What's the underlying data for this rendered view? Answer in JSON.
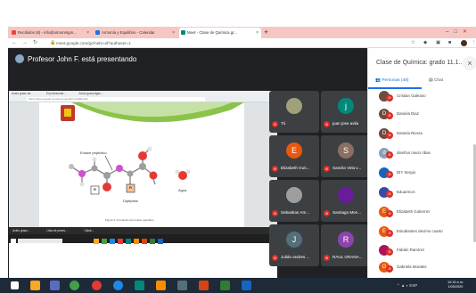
{
  "browser": {
    "tabs": [
      {
        "label": "Recibidos (8) - info@armonmgm...",
        "icon_color": "#e8453c"
      },
      {
        "label": "Armonía y Equilibrio - Calendar",
        "icon_color": "#1a73e8"
      },
      {
        "label": "Meet - Clase de Química gr...",
        "icon_color": "#00897b"
      }
    ],
    "url": "meet.google.com/gd-hebi-uif?authuser=1"
  },
  "stage": {
    "presenter_text": "Profesor John F. está presentando",
    "shared_tabs": [
      "Acido graso de...",
      "El profesional...",
      "Acido grasa ligan..."
    ],
    "shared_url": "https://docs.google.com/document/d/1yV3h8e/edit",
    "shared_taskbar": [
      "Acido graso...",
      "Lista de peces...",
      "Clase..."
    ],
    "diagram": {
      "label_peptide": "Enlace peptídico",
      "label_dipeptide": "Dipéptido",
      "label_water": "Agua",
      "label_r": "R",
      "caption": "Figura 3. Formación del enlace peptídico."
    }
  },
  "tiles": [
    {
      "name": "Tú",
      "initial": "",
      "color": "#a0a07a"
    },
    {
      "name": "juan jose avila",
      "initial": "j",
      "color": "#00897b"
    },
    {
      "name": "Elizabeth Guti...",
      "initial": "E",
      "color": "#e8590c"
    },
    {
      "name": "Sandra Vela v...",
      "initial": "S",
      "color": "#8d6e63"
    },
    {
      "name": "Sebastian Am...",
      "initial": "",
      "color": "#9e9e9e"
    },
    {
      "name": "Santiago Men...",
      "initial": "",
      "color": "#6a1b9a"
    },
    {
      "name": "Julián andres ...",
      "initial": "J",
      "color": "#546e7a"
    },
    {
      "name": "RAUL GRANA...",
      "initial": "R",
      "color": "#8e44ad"
    }
  ],
  "panel": {
    "title": "Clase de Química: grado 11.1...",
    "tab_people": "Personas (48)",
    "tab_chat": "Chat",
    "people": [
      {
        "name": "Cristian Galeano",
        "initial": "",
        "color": "#6d4c41"
      },
      {
        "name": "Daniela Diaz",
        "initial": "D",
        "color": "#6d4c41"
      },
      {
        "name": "Daniela Rivera",
        "initial": "D",
        "color": "#6d4c41"
      },
      {
        "name": "diseños marci ribas",
        "initial": "d",
        "color": "#8aa0b8"
      },
      {
        "name": "DIY Sergio",
        "initial": "",
        "color": "#1565c0"
      },
      {
        "name": "EduarmoA",
        "initial": "",
        "color": "#3949ab"
      },
      {
        "name": "Elizabeth Gutierrez",
        "initial": "E",
        "color": "#e8590c"
      },
      {
        "name": "Estudiantes decimo cuarto",
        "initial": "E",
        "color": "#e8590c"
      },
      {
        "name": "Fabián Ramírez",
        "initial": "",
        "color": "#ad1457"
      },
      {
        "name": "Gabriela Morales",
        "initial": "G",
        "color": "#e8590c"
      }
    ]
  },
  "taskbar": {
    "apps": [
      {
        "name": "windows-start",
        "color": "#ffffff"
      },
      {
        "name": "file-explorer",
        "color": "#f9a825"
      },
      {
        "name": "photos",
        "color": "#5c6bc0"
      },
      {
        "name": "chrome",
        "color": "#43a047"
      },
      {
        "name": "chrome-2",
        "color": "#e53935"
      },
      {
        "name": "edge",
        "color": "#1e88e5"
      },
      {
        "name": "app-7",
        "color": "#00897b"
      },
      {
        "name": "app-8",
        "color": "#fb8c00"
      },
      {
        "name": "app-9",
        "color": "#546e7a"
      },
      {
        "name": "powerpoint",
        "color": "#d84315"
      },
      {
        "name": "excel",
        "color": "#2e7d32"
      },
      {
        "name": "word",
        "color": "#1565c0"
      }
    ],
    "tray": "ESP",
    "time": "10:15 a.m.",
    "date": "1/05/2020"
  }
}
